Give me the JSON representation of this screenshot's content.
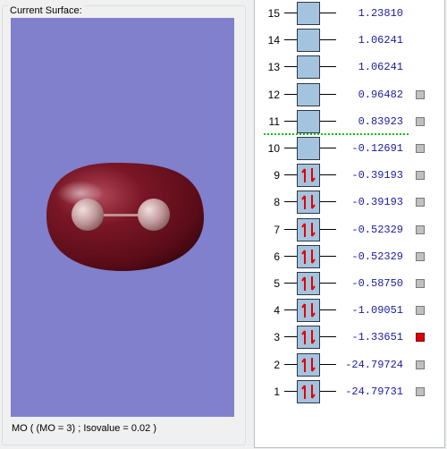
{
  "surface_group": {
    "title": "Current Surface:",
    "status": "MO ( (MO = 3) ; Isovalue = 0.02 )"
  },
  "mo_list": [
    {
      "index": "15",
      "energy": "1.23810",
      "occupied": false,
      "selectable": false,
      "selected": false
    },
    {
      "index": "14",
      "energy": "1.06241",
      "occupied": false,
      "selectable": false,
      "selected": false
    },
    {
      "index": "13",
      "energy": "1.06241",
      "occupied": false,
      "selectable": false,
      "selected": false
    },
    {
      "index": "12",
      "energy": "0.96482",
      "occupied": false,
      "selectable": true,
      "selected": false
    },
    {
      "index": "11",
      "energy": "0.83923",
      "occupied": false,
      "selectable": true,
      "selected": false
    },
    {
      "index": "10",
      "energy": "-0.12691",
      "occupied": false,
      "selectable": true,
      "selected": false
    },
    {
      "index": "9",
      "energy": "-0.39193",
      "occupied": true,
      "selectable": true,
      "selected": false
    },
    {
      "index": "8",
      "energy": "-0.39193",
      "occupied": true,
      "selectable": true,
      "selected": false
    },
    {
      "index": "7",
      "energy": "-0.52329",
      "occupied": true,
      "selectable": true,
      "selected": false
    },
    {
      "index": "6",
      "energy": "-0.52329",
      "occupied": true,
      "selectable": true,
      "selected": false
    },
    {
      "index": "5",
      "energy": "-0.58750",
      "occupied": true,
      "selectable": true,
      "selected": false
    },
    {
      "index": "4",
      "energy": "-1.09051",
      "occupied": true,
      "selectable": true,
      "selected": false
    },
    {
      "index": "3",
      "energy": "-1.33651",
      "occupied": true,
      "selectable": true,
      "selected": true
    },
    {
      "index": "2",
      "energy": "-24.79724",
      "occupied": true,
      "selectable": true,
      "selected": false
    },
    {
      "index": "1",
      "energy": "-24.79731",
      "occupied": true,
      "selectable": true,
      "selected": false
    }
  ],
  "homo_lumo_gap_after_index": "11",
  "colors": {
    "viewport_background": "#8080cc",
    "isosurface": "#6e1020",
    "atom": "#c8a0a0",
    "energy_text": "#1a1aa0",
    "selected_marker": "#e00000",
    "homo_lumo_line": "#11c011",
    "orbital_box": "#a4c3de"
  },
  "icons": {
    "occupied": "spin-pair-arrows-icon",
    "select": "select-square-icon"
  }
}
